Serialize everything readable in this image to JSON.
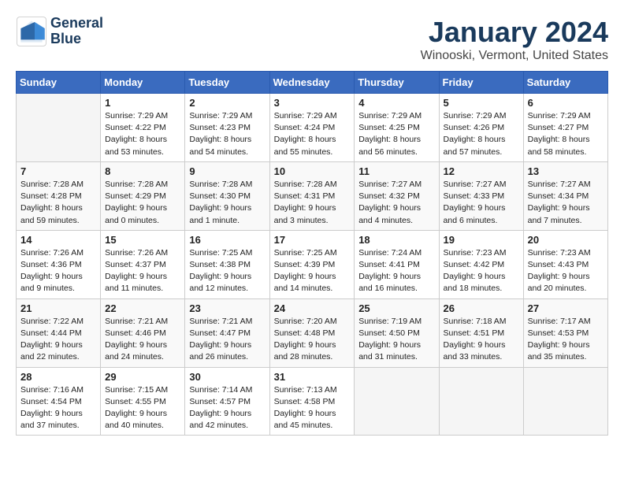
{
  "logo": {
    "text_line1": "General",
    "text_line2": "Blue"
  },
  "title": "January 2024",
  "subtitle": "Winooski, Vermont, United States",
  "days_of_week": [
    "Sunday",
    "Monday",
    "Tuesday",
    "Wednesday",
    "Thursday",
    "Friday",
    "Saturday"
  ],
  "weeks": [
    [
      {
        "day": "",
        "sunrise": "",
        "sunset": "",
        "daylight": ""
      },
      {
        "day": "1",
        "sunrise": "Sunrise: 7:29 AM",
        "sunset": "Sunset: 4:22 PM",
        "daylight": "Daylight: 8 hours and 53 minutes."
      },
      {
        "day": "2",
        "sunrise": "Sunrise: 7:29 AM",
        "sunset": "Sunset: 4:23 PM",
        "daylight": "Daylight: 8 hours and 54 minutes."
      },
      {
        "day": "3",
        "sunrise": "Sunrise: 7:29 AM",
        "sunset": "Sunset: 4:24 PM",
        "daylight": "Daylight: 8 hours and 55 minutes."
      },
      {
        "day": "4",
        "sunrise": "Sunrise: 7:29 AM",
        "sunset": "Sunset: 4:25 PM",
        "daylight": "Daylight: 8 hours and 56 minutes."
      },
      {
        "day": "5",
        "sunrise": "Sunrise: 7:29 AM",
        "sunset": "Sunset: 4:26 PM",
        "daylight": "Daylight: 8 hours and 57 minutes."
      },
      {
        "day": "6",
        "sunrise": "Sunrise: 7:29 AM",
        "sunset": "Sunset: 4:27 PM",
        "daylight": "Daylight: 8 hours and 58 minutes."
      }
    ],
    [
      {
        "day": "7",
        "sunrise": "Sunrise: 7:28 AM",
        "sunset": "Sunset: 4:28 PM",
        "daylight": "Daylight: 8 hours and 59 minutes."
      },
      {
        "day": "8",
        "sunrise": "Sunrise: 7:28 AM",
        "sunset": "Sunset: 4:29 PM",
        "daylight": "Daylight: 9 hours and 0 minutes."
      },
      {
        "day": "9",
        "sunrise": "Sunrise: 7:28 AM",
        "sunset": "Sunset: 4:30 PM",
        "daylight": "Daylight: 9 hours and 1 minute."
      },
      {
        "day": "10",
        "sunrise": "Sunrise: 7:28 AM",
        "sunset": "Sunset: 4:31 PM",
        "daylight": "Daylight: 9 hours and 3 minutes."
      },
      {
        "day": "11",
        "sunrise": "Sunrise: 7:27 AM",
        "sunset": "Sunset: 4:32 PM",
        "daylight": "Daylight: 9 hours and 4 minutes."
      },
      {
        "day": "12",
        "sunrise": "Sunrise: 7:27 AM",
        "sunset": "Sunset: 4:33 PM",
        "daylight": "Daylight: 9 hours and 6 minutes."
      },
      {
        "day": "13",
        "sunrise": "Sunrise: 7:27 AM",
        "sunset": "Sunset: 4:34 PM",
        "daylight": "Daylight: 9 hours and 7 minutes."
      }
    ],
    [
      {
        "day": "14",
        "sunrise": "Sunrise: 7:26 AM",
        "sunset": "Sunset: 4:36 PM",
        "daylight": "Daylight: 9 hours and 9 minutes."
      },
      {
        "day": "15",
        "sunrise": "Sunrise: 7:26 AM",
        "sunset": "Sunset: 4:37 PM",
        "daylight": "Daylight: 9 hours and 11 minutes."
      },
      {
        "day": "16",
        "sunrise": "Sunrise: 7:25 AM",
        "sunset": "Sunset: 4:38 PM",
        "daylight": "Daylight: 9 hours and 12 minutes."
      },
      {
        "day": "17",
        "sunrise": "Sunrise: 7:25 AM",
        "sunset": "Sunset: 4:39 PM",
        "daylight": "Daylight: 9 hours and 14 minutes."
      },
      {
        "day": "18",
        "sunrise": "Sunrise: 7:24 AM",
        "sunset": "Sunset: 4:41 PM",
        "daylight": "Daylight: 9 hours and 16 minutes."
      },
      {
        "day": "19",
        "sunrise": "Sunrise: 7:23 AM",
        "sunset": "Sunset: 4:42 PM",
        "daylight": "Daylight: 9 hours and 18 minutes."
      },
      {
        "day": "20",
        "sunrise": "Sunrise: 7:23 AM",
        "sunset": "Sunset: 4:43 PM",
        "daylight": "Daylight: 9 hours and 20 minutes."
      }
    ],
    [
      {
        "day": "21",
        "sunrise": "Sunrise: 7:22 AM",
        "sunset": "Sunset: 4:44 PM",
        "daylight": "Daylight: 9 hours and 22 minutes."
      },
      {
        "day": "22",
        "sunrise": "Sunrise: 7:21 AM",
        "sunset": "Sunset: 4:46 PM",
        "daylight": "Daylight: 9 hours and 24 minutes."
      },
      {
        "day": "23",
        "sunrise": "Sunrise: 7:21 AM",
        "sunset": "Sunset: 4:47 PM",
        "daylight": "Daylight: 9 hours and 26 minutes."
      },
      {
        "day": "24",
        "sunrise": "Sunrise: 7:20 AM",
        "sunset": "Sunset: 4:48 PM",
        "daylight": "Daylight: 9 hours and 28 minutes."
      },
      {
        "day": "25",
        "sunrise": "Sunrise: 7:19 AM",
        "sunset": "Sunset: 4:50 PM",
        "daylight": "Daylight: 9 hours and 31 minutes."
      },
      {
        "day": "26",
        "sunrise": "Sunrise: 7:18 AM",
        "sunset": "Sunset: 4:51 PM",
        "daylight": "Daylight: 9 hours and 33 minutes."
      },
      {
        "day": "27",
        "sunrise": "Sunrise: 7:17 AM",
        "sunset": "Sunset: 4:53 PM",
        "daylight": "Daylight: 9 hours and 35 minutes."
      }
    ],
    [
      {
        "day": "28",
        "sunrise": "Sunrise: 7:16 AM",
        "sunset": "Sunset: 4:54 PM",
        "daylight": "Daylight: 9 hours and 37 minutes."
      },
      {
        "day": "29",
        "sunrise": "Sunrise: 7:15 AM",
        "sunset": "Sunset: 4:55 PM",
        "daylight": "Daylight: 9 hours and 40 minutes."
      },
      {
        "day": "30",
        "sunrise": "Sunrise: 7:14 AM",
        "sunset": "Sunset: 4:57 PM",
        "daylight": "Daylight: 9 hours and 42 minutes."
      },
      {
        "day": "31",
        "sunrise": "Sunrise: 7:13 AM",
        "sunset": "Sunset: 4:58 PM",
        "daylight": "Daylight: 9 hours and 45 minutes."
      },
      {
        "day": "",
        "sunrise": "",
        "sunset": "",
        "daylight": ""
      },
      {
        "day": "",
        "sunrise": "",
        "sunset": "",
        "daylight": ""
      },
      {
        "day": "",
        "sunrise": "",
        "sunset": "",
        "daylight": ""
      }
    ]
  ]
}
